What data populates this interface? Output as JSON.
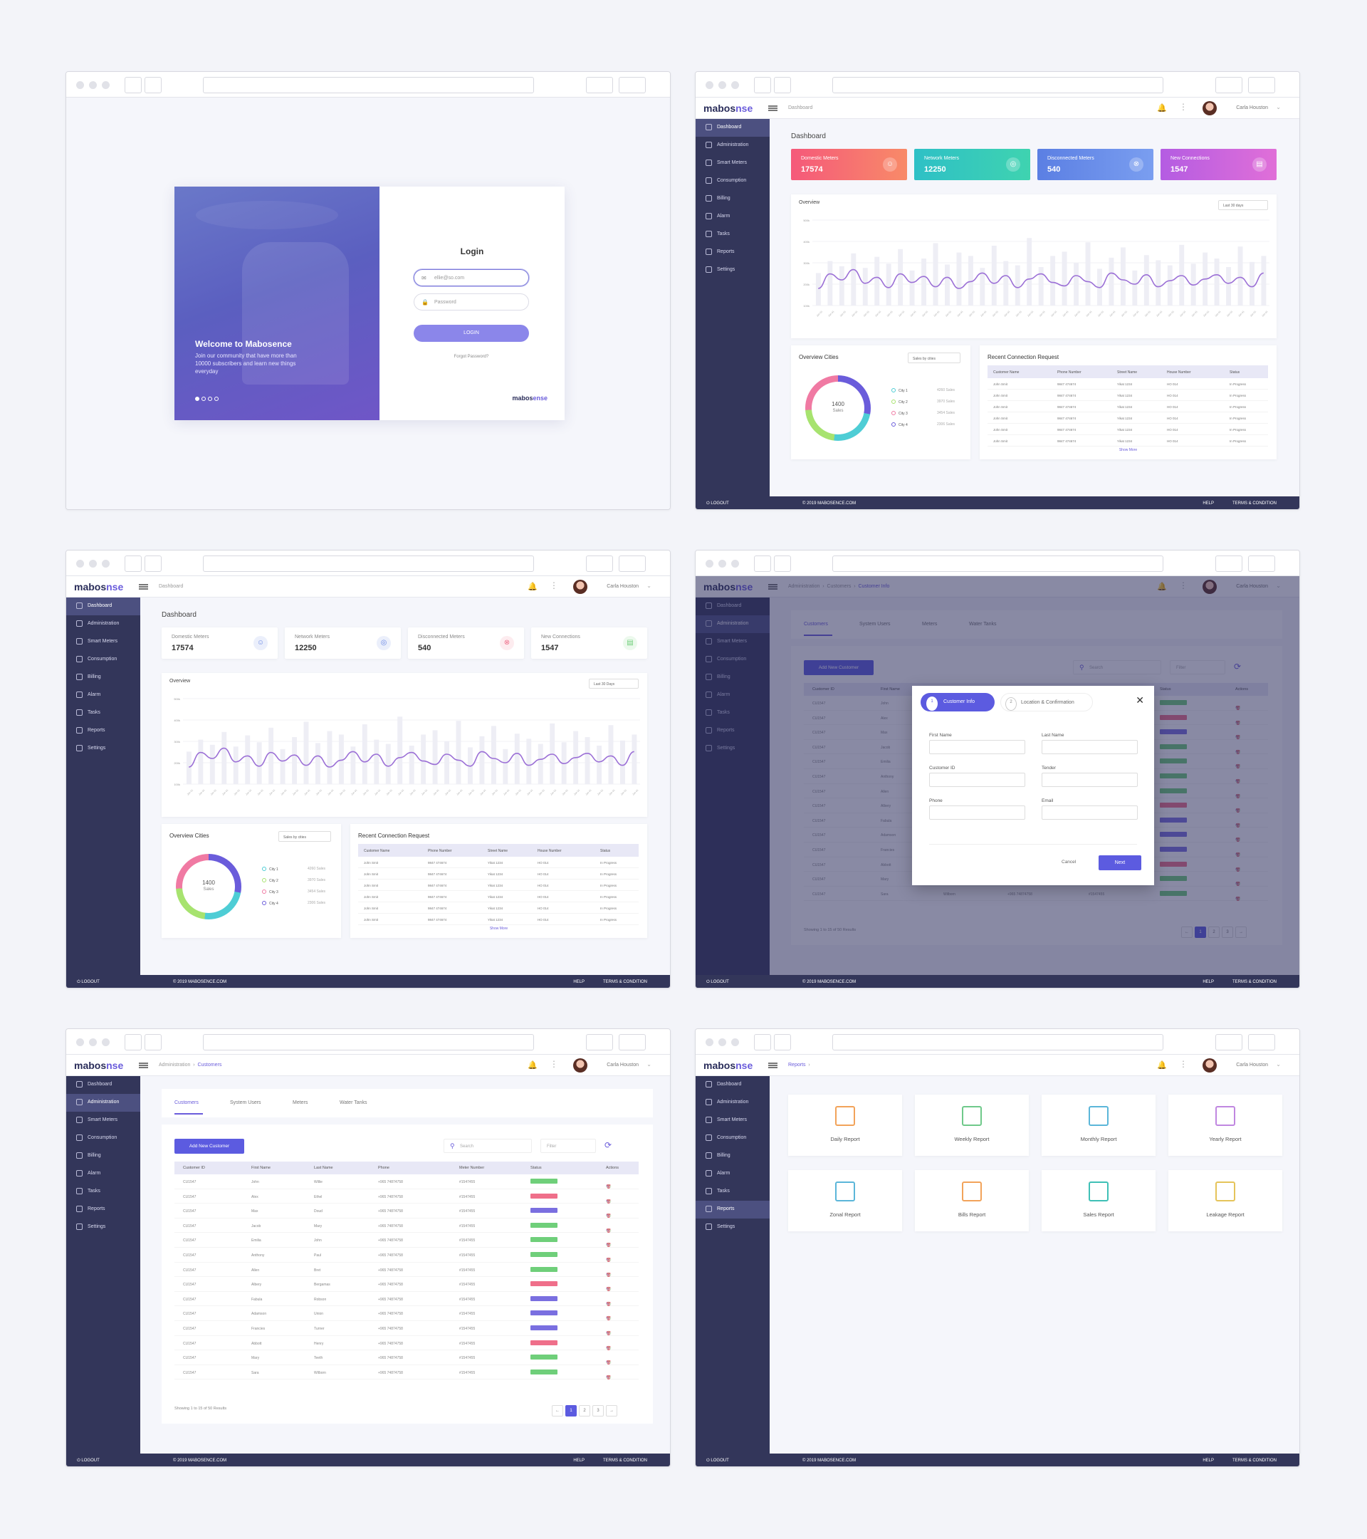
{
  "login": {
    "title": "Login",
    "welcome": "Welcome to Mabosence",
    "subtitle": "Join our community that have more than 10000 subscribers and learn new things everyday",
    "email_value": "ellie@so.com",
    "password_placeholder": "Password",
    "button": "LOGIN",
    "forgot": "Forgot Password?",
    "logo_a": "mabos",
    "logo_b": "ense"
  },
  "brand": {
    "logo_a": "mabos",
    "logo_b": "nse"
  },
  "user": {
    "name": "Carla Houston"
  },
  "sidebar": {
    "items": [
      {
        "label": "Dashboard",
        "icon": "dashboard-icon"
      },
      {
        "label": "Administration",
        "icon": "admin-icon"
      },
      {
        "label": "Smart Meters",
        "icon": "meter-icon"
      },
      {
        "label": "Consumption",
        "icon": "consumption-icon"
      },
      {
        "label": "Billing",
        "icon": "billing-icon"
      },
      {
        "label": "Alarm",
        "icon": "alarm-icon"
      },
      {
        "label": "Tasks",
        "icon": "tasks-icon"
      },
      {
        "label": "Reports",
        "icon": "reports-icon"
      },
      {
        "label": "Settings",
        "icon": "settings-icon"
      }
    ]
  },
  "footer": {
    "logout": "LOGOUT",
    "copyright": "© 2019 MABOSENCE.COM",
    "help": "HELP",
    "terms": "TERMS & CONDITION"
  },
  "breadcrumbs": {
    "dashboard": "Dashboard",
    "admin": "Administration",
    "customers": "Customers",
    "customer_info": "Customer Info",
    "reports": "Reports"
  },
  "dashboard": {
    "title": "Dashboard",
    "stats": [
      {
        "label": "Domestic Meters",
        "value": "17574",
        "color": "#f2676f"
      },
      {
        "label": "Network Meters",
        "value": "12250",
        "color": "#3cc3c6"
      },
      {
        "label": "Disconnected Meters",
        "value": "540",
        "color": "#6a88e4"
      },
      {
        "label": "New Connections",
        "value": "1547",
        "color": "#b067e0"
      }
    ],
    "overview_title": "Overview",
    "overview_select_a": "Last 30 days",
    "overview_select_b": "Last 30 Days",
    "cities_title": "Overview Cities",
    "cities_select": "Sales by cities",
    "donut_value": "1400",
    "donut_label": "Sales",
    "cities": [
      {
        "name": "City 1",
        "sales": "4260 Sales",
        "color": "#4ecdd5"
      },
      {
        "name": "City 2",
        "sales": "3970 Sales",
        "color": "#a7e36f"
      },
      {
        "name": "City 3",
        "sales": "3454 Sales",
        "color": "#f07aa3"
      },
      {
        "name": "City 4",
        "sales": "2306 Sales",
        "color": "#6a5cdb"
      }
    ],
    "recent_title": "Recent Connection Request",
    "recent_headers": [
      "Customer Name",
      "Phone Number",
      "Street Name",
      "House Number",
      "Status"
    ],
    "recent_rows": [
      [
        "John Smit",
        "9847 474674",
        "Yikat 1234",
        "HO 014",
        "In Progress"
      ],
      [
        "John Smit",
        "9847 474674",
        "Yikat 1234",
        "HO 014",
        "In Progress"
      ],
      [
        "John Smit",
        "9847 474674",
        "Yikat 1234",
        "HO 014",
        "In Progress"
      ],
      [
        "John Smit",
        "9847 474674",
        "Yikat 1234",
        "HO 014",
        "In Progress"
      ],
      [
        "John Smit",
        "9847 474674",
        "Yikat 1234",
        "HO 014",
        "In Progress"
      ],
      [
        "John Smit",
        "9847 474674",
        "Yikat 1234",
        "HO 014",
        "In Progress"
      ]
    ],
    "show_more": "Show More"
  },
  "customers": {
    "tabs": [
      "Customers",
      "System Users",
      "Meters",
      "Water Tanks"
    ],
    "add_button": "Add New Customer",
    "search_placeholder": "Search",
    "filter": "Filter",
    "headers": [
      "Customer ID",
      "First Name",
      "Last Name",
      "Phone",
      "Meter Number",
      "Status",
      "Actions"
    ],
    "rows": [
      [
        "CU1547",
        "John",
        "Willie",
        "+965 74874758",
        "#1547455",
        "#6fcf7a"
      ],
      [
        "CU1547",
        "Alex",
        "Ethel",
        "+965 74874758",
        "#1547455",
        "#ef6f8a"
      ],
      [
        "CU1547",
        "Max",
        "Doud",
        "+965 74874758",
        "#1547455",
        "#7a6fe0"
      ],
      [
        "CU1547",
        "Jacob",
        "Mary",
        "+965 74874758",
        "#1547455",
        "#6fcf7a"
      ],
      [
        "CU1547",
        "Emilia",
        "John",
        "+965 74874758",
        "#1547455",
        "#6fcf7a"
      ],
      [
        "CU1547",
        "Anthony",
        "Paul",
        "+965 74874758",
        "#1547455",
        "#6fcf7a"
      ],
      [
        "CU1547",
        "Allen",
        "Bret",
        "+965 74874758",
        "#1547455",
        "#6fcf7a"
      ],
      [
        "CU1547",
        "Albery",
        "Bergamas",
        "+965 74874758",
        "#1547455",
        "#ef6f8a"
      ],
      [
        "CU1547",
        "Fabula",
        "Robson",
        "+965 74874758",
        "#1547455",
        "#7a6fe0"
      ],
      [
        "CU1547",
        "Adamson",
        "Union",
        "+965 74874758",
        "#1547455",
        "#7a6fe0"
      ],
      [
        "CU1547",
        "Francies",
        "Turner",
        "+965 74874758",
        "#1547455",
        "#7a6fe0"
      ],
      [
        "CU1547",
        "Abbott",
        "Henry",
        "+965 74874758",
        "#1547455",
        "#ef6f8a"
      ],
      [
        "CU1547",
        "Mary",
        "Teeth",
        "+965 74874758",
        "#1547455",
        "#6fcf7a"
      ],
      [
        "CU1547",
        "Sara",
        "Wilborn",
        "+965 74874758",
        "#1547455",
        "#6fcf7a"
      ]
    ],
    "showing": "Showing 1 to 15 of 50 Results",
    "pages": [
      "←",
      "1",
      "2",
      "3",
      "→"
    ]
  },
  "modal": {
    "step1": "Customer Info",
    "step2": "Location & Confirmation",
    "first_name": "First Name",
    "last_name": "Last Name",
    "customer_id": "Customer ID",
    "tender": "Tender",
    "phone": "Phone",
    "email": "Email",
    "cancel": "Cancel",
    "next": "Next"
  },
  "reports": [
    {
      "label": "Daily Report",
      "color": "#f2a35a"
    },
    {
      "label": "Weekly Report",
      "color": "#6fc98a"
    },
    {
      "label": "Monthly Report",
      "color": "#5bb6d9"
    },
    {
      "label": "Yearly Report",
      "color": "#c087e0"
    },
    {
      "label": "Zonal Report",
      "color": "#5bb6d9"
    },
    {
      "label": "Bills Report",
      "color": "#f2a35a"
    },
    {
      "label": "Sales Report",
      "color": "#3fc0b6"
    },
    {
      "label": "Leakage Report",
      "color": "#e5c45a"
    }
  ],
  "chart_data": {
    "type": "line",
    "title": "Overview",
    "y_ticks": [
      "100k",
      "200k",
      "300k",
      "400k",
      "500k"
    ],
    "bars": [
      38,
      52,
      46,
      61,
      44,
      57,
      49,
      66,
      41,
      55,
      73,
      48,
      62,
      58,
      44,
      70,
      52,
      47,
      79,
      45,
      58,
      63,
      50,
      74,
      43,
      56,
      68,
      41,
      59,
      53,
      47,
      71,
      49,
      62,
      55,
      45,
      69,
      51,
      58
    ],
    "line": [
      20,
      37,
      30,
      42,
      26,
      33,
      21,
      37,
      27,
      34,
      22,
      33,
      20,
      28,
      38,
      26,
      35,
      21,
      31,
      37,
      27,
      23,
      35,
      28,
      21,
      38,
      30,
      25,
      36,
      22,
      29,
      35,
      24,
      31,
      36,
      26,
      33,
      22,
      38
    ]
  }
}
